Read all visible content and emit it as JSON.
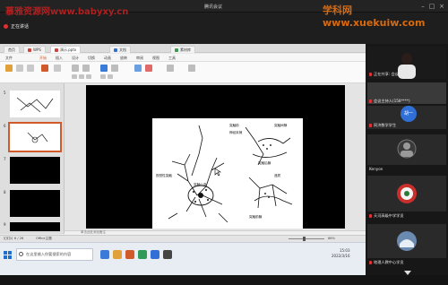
{
  "watermark_left": "慕雅资源网www.babyxy.cn",
  "watermark_right": "学科网www.xuekuiw.com",
  "meeting": {
    "title": "腾讯会议",
    "mic_label": "正在讲话"
  },
  "wps": {
    "tabs": [
      {
        "label": "首页"
      },
      {
        "label": "WPS"
      },
      {
        "label": "演示.pptx",
        "active": true
      },
      {
        "label": "文档"
      },
      {
        "label": "素材库"
      }
    ],
    "menu": [
      "文件",
      "开始",
      "插入",
      "设计",
      "切换",
      "动画",
      "放映",
      "审阅",
      "视图",
      "工具"
    ],
    "thumbnails": [
      {
        "num": "5"
      },
      {
        "num": "6"
      },
      {
        "num": "7"
      },
      {
        "num": "8"
      },
      {
        "num": "9"
      }
    ],
    "figure_labels": {
      "l1": "视觉性突触",
      "l2": "突触前",
      "l3": "神经末梢",
      "l4": "突触间隙",
      "l5": "突触后膜",
      "l6": "突触小泡",
      "l7": "递质",
      "l8": "突触前膜"
    },
    "note_text": "单击此处添加备注",
    "status": {
      "slide_info": "幻灯片 6 / 26",
      "theme": "Office主题",
      "zoom": "66%"
    }
  },
  "taskbar": {
    "search_placeholder": "在这里输入你要搜索的内容",
    "time": "15:03",
    "date": "2022/3/16"
  },
  "participants": [
    {
      "name": "正在共享: 会议主持人",
      "avatar": "",
      "color": "#6b6b6b",
      "photo": true
    },
    {
      "name": "会议主持人(158****)",
      "avatar": "",
      "color": "#4a6fa8",
      "photo": false
    },
    {
      "name": "同济数学学生",
      "avatar": "胡一",
      "color": "#2f6fd6",
      "photo": false
    },
    {
      "name": "Kenyon",
      "avatar": "",
      "color": "#5a5a5a",
      "photo": true
    },
    {
      "name": "天河高级中学学员",
      "avatar": "",
      "color": "#8a2a2a",
      "photo": true
    },
    {
      "name": "地理人教中心学员",
      "avatar": "",
      "color": "#3a5a78",
      "photo": true
    }
  ],
  "colors": {
    "accent": "#d05a2a",
    "meeting_bg": "#1e1e1e",
    "avatar_blue": "#2f6fd6"
  }
}
